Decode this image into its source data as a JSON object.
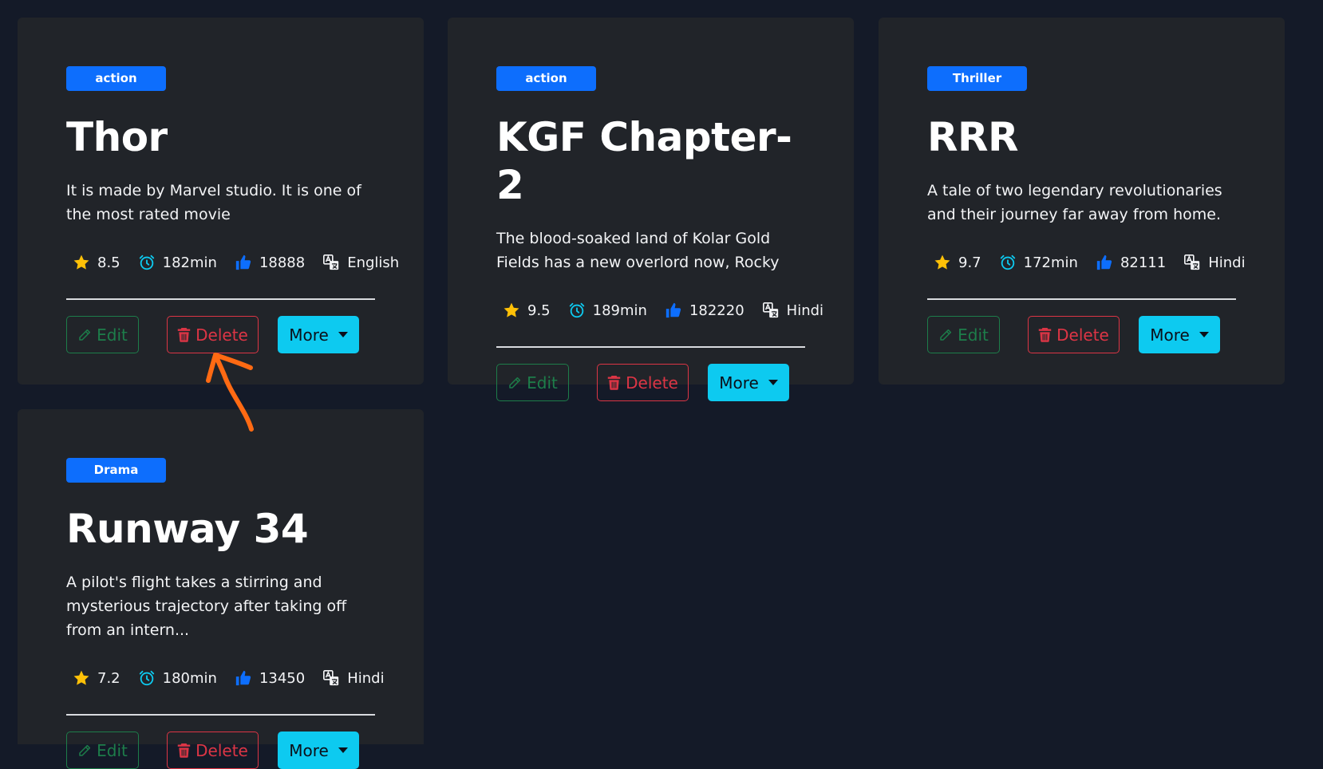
{
  "cards": [
    {
      "genre": "action",
      "title": "Thor",
      "description": "It is made by Marvel studio. It is one of the most rated movie",
      "rating": "8.5",
      "duration": "182min",
      "likes": "18888",
      "language": "English",
      "edit_label": "Edit",
      "delete_label": "Delete",
      "more_label": "More"
    },
    {
      "genre": "action",
      "title": "KGF Chapter-2",
      "description": "The blood-soaked land of Kolar Gold Fields has a new overlord now, Rocky",
      "rating": "9.5",
      "duration": "189min",
      "likes": "182220",
      "language": "Hindi",
      "edit_label": "Edit",
      "delete_label": "Delete",
      "more_label": "More"
    },
    {
      "genre": "Thriller",
      "title": "RRR",
      "description": "A tale of two legendary revolutionaries and their journey far away from home.",
      "rating": "9.7",
      "duration": "172min",
      "likes": "82111",
      "language": "Hindi",
      "edit_label": "Edit",
      "delete_label": "Delete",
      "more_label": "More"
    },
    {
      "genre": "Drama",
      "title": "Runway 34",
      "description": "A pilot's flight takes a stirring and mysterious trajectory after taking off from an intern...",
      "rating": "7.2",
      "duration": "180min",
      "likes": "13450",
      "language": "Hindi",
      "edit_label": "Edit",
      "delete_label": "Delete",
      "more_label": "More"
    }
  ],
  "colors": {
    "page_background": "#141a28",
    "card_background": "#212429",
    "badge": "#0d6efd",
    "star": "#ffc107",
    "clock": "#0dcaf0",
    "thumb": "#0d6efd",
    "edit": "#1d7d4a",
    "delete": "#dc3545",
    "more": "#0dcaf0",
    "annotation_arrow": "#ff6a13"
  },
  "icons": [
    "star-icon",
    "alarm-clock-icon",
    "thumbs-up-icon",
    "translate-icon",
    "pencil-icon",
    "trash-icon",
    "caret-down-icon"
  ]
}
